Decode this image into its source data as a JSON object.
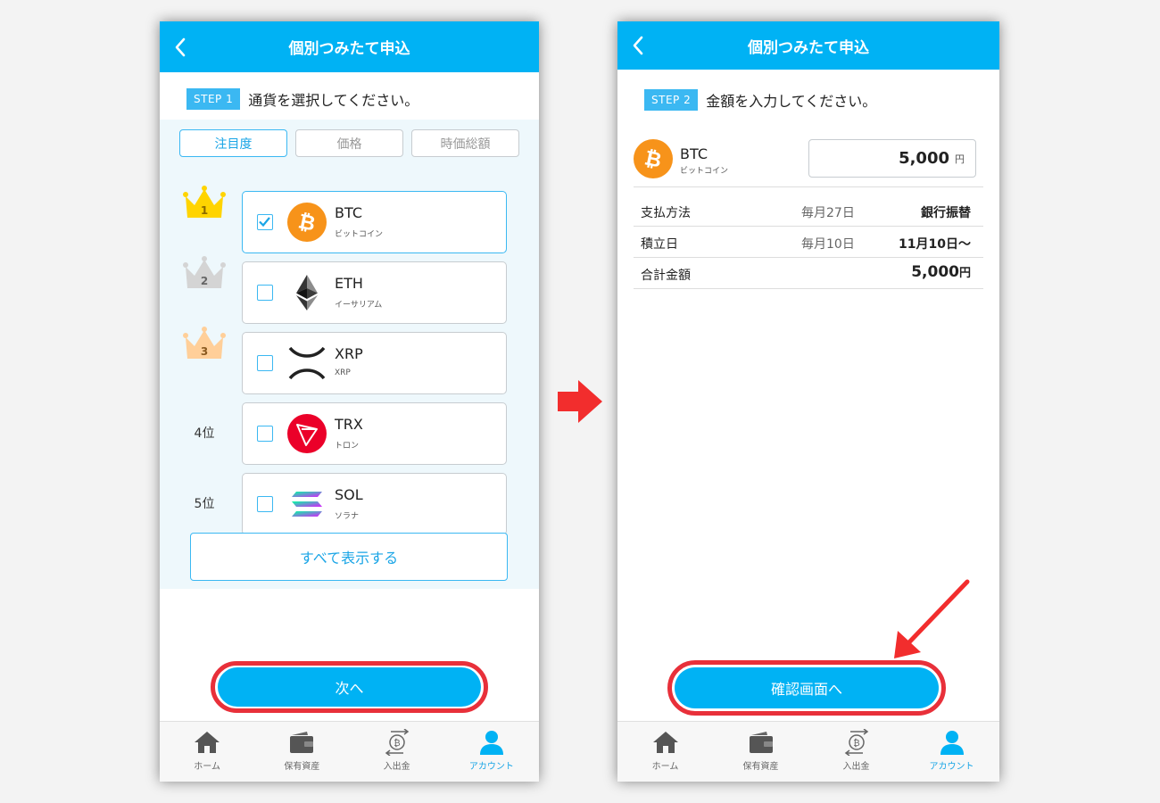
{
  "left": {
    "title": "個別つみたて申込",
    "step_badge": "STEP 1",
    "step_text": "通貨を選択してください。",
    "sort_tabs": [
      "注目度",
      "価格",
      "時価総額"
    ],
    "ranks": [
      "1",
      "2",
      "3",
      "4位",
      "5位"
    ],
    "coins": [
      {
        "symbol": "BTC",
        "name": "ビットコイン",
        "checked": true
      },
      {
        "symbol": "ETH",
        "name": "イーサリアム",
        "checked": false
      },
      {
        "symbol": "XRP",
        "name": "XRP",
        "checked": false
      },
      {
        "symbol": "TRX",
        "name": "トロン",
        "checked": false
      },
      {
        "symbol": "SOL",
        "name": "ソラナ",
        "checked": false
      }
    ],
    "show_all": "すべて表示する",
    "next": "次へ"
  },
  "right": {
    "title": "個別つみたて申込",
    "step_badge": "STEP 2",
    "step_text": "金額を入力してください。",
    "coin_symbol": "BTC",
    "coin_name": "ビットコイン",
    "amount": "5,000",
    "amount_unit": "円",
    "rows": [
      {
        "label": "支払方法",
        "mid": "毎月27日",
        "value": "銀行振替"
      },
      {
        "label": "積立日",
        "mid": "毎月10日",
        "value": "11月10日〜"
      },
      {
        "label": "合計金額",
        "mid": "",
        "value": "5,000",
        "unit": "円"
      }
    ],
    "confirm": "確認画面へ"
  },
  "tabbar": [
    {
      "label": "ホーム",
      "icon": "home-icon"
    },
    {
      "label": "保有資産",
      "icon": "wallet-icon"
    },
    {
      "label": "入出金",
      "icon": "transfer-icon"
    },
    {
      "label": "アカウント",
      "icon": "account-icon"
    }
  ],
  "colors": {
    "primary": "#00b2f4",
    "highlight": "#e8303a",
    "gold": "#ffd400",
    "silver": "#d4d4d4",
    "bronze": "#ffcf99"
  }
}
